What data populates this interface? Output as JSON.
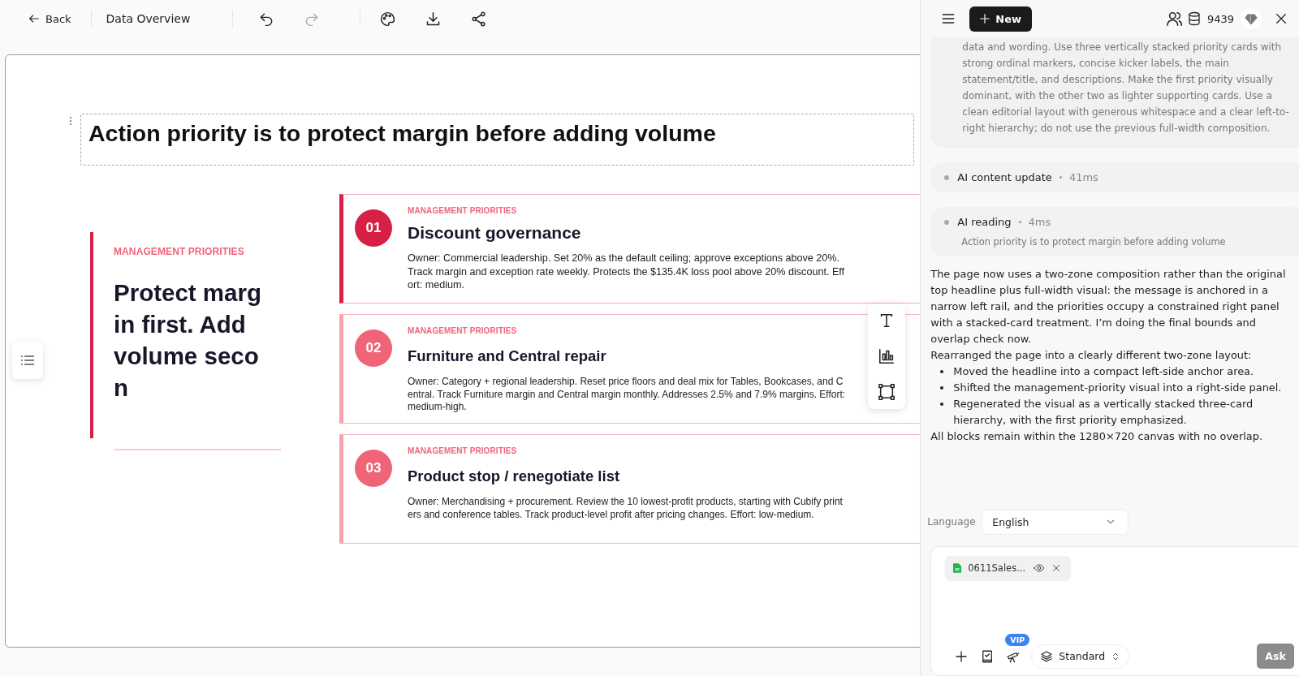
{
  "toolbar": {
    "back": "Back",
    "title": "Data Overview",
    "actions": [
      {
        "kind": "undo",
        "disabled": false
      },
      {
        "kind": "redo",
        "disabled": true
      },
      {
        "kind": "palette",
        "disabled": false
      },
      {
        "kind": "download",
        "disabled": false
      },
      {
        "kind": "share",
        "disabled": false
      }
    ]
  },
  "slide": {
    "title": "Action priority is to protect margin before adding volume",
    "rail": {
      "kicker": "MANAGEMENT PRIORITIES",
      "headline": "Protect margin first. Add volume secon"
    },
    "cards": [
      {
        "number": "01",
        "kicker": "MANAGEMENT PRIORITIES",
        "title": "Discount governance",
        "description": "Owner: Commercial leadership. Set 20% as the default ceiling; approve exceptions above 20%. Track margin and exception rate weekly. Protects the $135.4K loss pool above 20% discount. Effort: medium.",
        "emphasized": true
      },
      {
        "number": "02",
        "kicker": "MANAGEMENT PRIORITIES",
        "title": "Furniture and Central repair",
        "description": "Owner: Category + regional leadership. Reset price floors and deal mix for Tables, Bookcases, and Central. Track Furniture margin and Central margin monthly. Addresses 2.5% and 7.9% margins. Effort: medium-high.",
        "emphasized": false
      },
      {
        "number": "03",
        "kicker": "MANAGEMENT PRIORITIES",
        "title": "Product stop / renegotiate list",
        "description": "Owner: Merchandising + procurement. Review the 10 lowest-profit products, starting with Cubify printers and conference tables. Track product-level profit after pricing changes. Effort: low-medium.",
        "emphasized": false
      }
    ]
  },
  "assistant": {
    "new_button": "New",
    "credits": "9439",
    "prompt": "data and wording. Use three vertically stacked priority cards with strong ordinal markers, concise kicker labels, the main statement/title, and descriptions. Make the first priority visually dominant, with the other two as lighter supporting cards. Use a clean editorial layout with generous whitespace and a clear left-to-right hierarchy; do not use the previous full-width composition.",
    "steps": [
      {
        "label": "AI content update",
        "duration": "41ms"
      },
      {
        "label": "AI reading",
        "duration": "4ms",
        "detail": "Action priority is to protect margin before adding volume"
      }
    ],
    "answer": [
      {
        "kind": "paragraph",
        "text": "The page now uses a two-zone composition rather than the original top headline plus full-width visual: the message is anchored in a narrow left rail, and the priorities occupy a constrained right panel with a stacked-card treatment. I’m doing the final bounds and overlap check now."
      },
      {
        "kind": "paragraph",
        "text": "Rearranged the page into a clearly different two-zone layout:"
      },
      {
        "kind": "bullets",
        "items": [
          "Moved the headline into a compact left-side anchor area.",
          "Shifted the management-priority visual into a right-side panel.",
          "Regenerated the visual as a vertically stacked three-card hierarchy, with the first priority emphasized."
        ]
      },
      {
        "kind": "paragraph",
        "text": "All blocks remain within the 1280×720 canvas with no overlap."
      }
    ],
    "language": {
      "label": "Language",
      "value": "English"
    },
    "composer": {
      "attachment": "0611Sales...",
      "vip_badge": "VIP",
      "mode": "Standard",
      "ask_button": "Ask"
    }
  }
}
